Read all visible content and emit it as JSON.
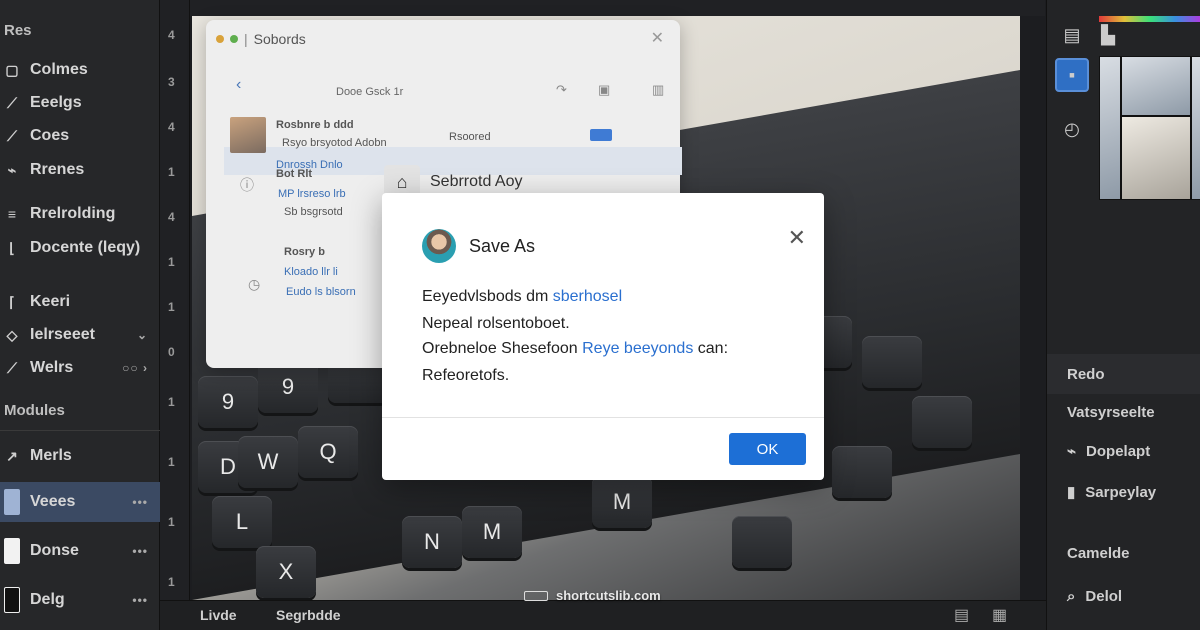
{
  "sidebar": {
    "top_label": "Res",
    "items": [
      {
        "label": "Colmes",
        "icon": "square-icon"
      },
      {
        "label": "Eeelgs",
        "icon": "pen-icon"
      },
      {
        "label": "Coes",
        "icon": "pen-icon"
      },
      {
        "label": "Rrenes",
        "icon": "link-icon"
      },
      {
        "label": "Rrelrolding",
        "icon": "layers-icon"
      },
      {
        "label": "Docente (leqy)",
        "icon": "bracket-icon"
      },
      {
        "label": "Keeri",
        "icon": "bracket-icon"
      },
      {
        "label": "Ielrseeet",
        "icon": "diamond-icon"
      },
      {
        "label": "Welrs",
        "icon": "pen-icon"
      }
    ],
    "section_label": "Modules",
    "lower_items": [
      {
        "label": "Merls",
        "icon": "arrow-icon"
      },
      {
        "label": "Veees",
        "icon": "thumb-blue"
      },
      {
        "label": "Donse",
        "icon": "thumb-white"
      },
      {
        "label": "Delg",
        "icon": "thumb-dark"
      }
    ]
  },
  "bg_window": {
    "title": "Sobords",
    "nav_title": "Dooe Gsck 1r",
    "item1_title": "Rosbnre b ddd",
    "item1_sub": "Rsyo brsyotod Adobn",
    "item1_extra": "Rsoored",
    "item1_link": "Dnrossh Dnlo",
    "item2_title": "Bot Rlt",
    "item2_sub1": "MP lrsreso lrb",
    "item2_sub2": "Sb bsgrsotd",
    "item3_title": "Rosry b",
    "item3_sub1": "Kloado llr li",
    "item3_sub2": "Eudo ls blsorn"
  },
  "saved_label": "Sebrrotd Aoy",
  "dialog": {
    "title": "Save As",
    "line1_text": "Eeyedvlsbods dm",
    "line1_link": "sberhosel",
    "line2": "Nepeal rolsentoboet.",
    "line3_text": "Orebneloe Shesefoon",
    "line3_link": "Reye beeyonds",
    "line3_tail": "can:",
    "line4": "Refeoretofs.",
    "ok_label": "OK"
  },
  "keys": [
    "9",
    "9",
    "D",
    "W",
    "Q",
    "L",
    "N",
    "X",
    "M",
    "M"
  ],
  "rpanel": {
    "section1": "Redo",
    "item_a": "Vatsyrseelte",
    "item_b": "Dopelapt",
    "item_c": "Sarpeylay",
    "item_d": "Camelde",
    "item_e": "Delol"
  },
  "bottom": {
    "left": "Livde",
    "mid": "Segrbdde"
  },
  "watermark": "shortcutslib.com",
  "ruler_v": [
    "4",
    "3",
    "4",
    "1",
    "4",
    "1",
    "1",
    "0",
    "1",
    "1",
    "1",
    "1"
  ],
  "colors": {
    "accent": "#1d6fd6",
    "link": "#2a6fcf",
    "sidebar_active": "#3b4a63"
  }
}
